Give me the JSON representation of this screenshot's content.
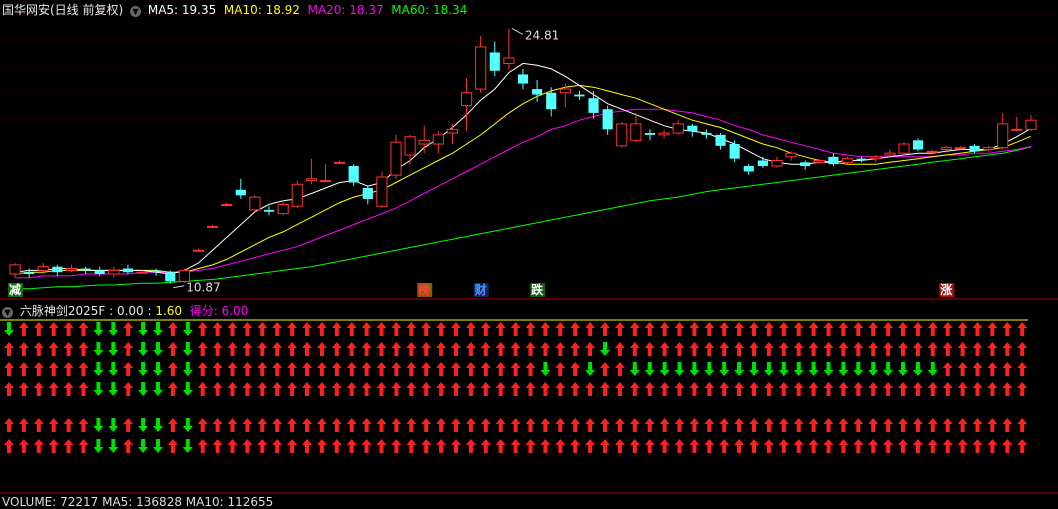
{
  "header": {
    "title": "国华网安(日线 前复权)",
    "ma5_label": "MA5: 19.35",
    "ma10_label": "MA10: 18.92",
    "ma20_label": "MA20: 18.37",
    "ma60_label": "MA60: 18.34"
  },
  "colors": {
    "up": "#ff3232",
    "down": "#54ffff",
    "ma5": "#ffffff",
    "ma10": "#ffff00",
    "ma20": "#ff00ff",
    "ma60": "#00ff00",
    "arrow_up": "#ff2020",
    "arrow_down": "#00e000"
  },
  "price_panel": {
    "high_label": "24.81",
    "low_label": "10.87",
    "signals": [
      {
        "text": "减",
        "color": "#ffffff",
        "bg": "#107010",
        "index": 0
      },
      {
        "text": "榜",
        "color": "#ff4040",
        "bg": "#806000",
        "index": 29
      },
      {
        "text": "财",
        "color": "#40a0ff",
        "bg": "#202060",
        "index": 33
      },
      {
        "text": "跌",
        "color": "#ffffff",
        "bg": "#106010",
        "index": 37
      },
      {
        "text": "涨",
        "color": "#ffffff",
        "bg": "#a01010",
        "index": 66
      }
    ]
  },
  "indicator": {
    "name": "六脉神剑2025F",
    "sep1": " : ",
    "v1": "0.00",
    "sep2": " : ",
    "v2": "1.60",
    "score_label": "得分: ",
    "score": "6.00"
  },
  "volume_label": "VOLUME: 72217  MA5: 136828  MA10: 112655",
  "chart_data": {
    "type": "candlestick",
    "ylim": [
      10.2,
      25.6
    ],
    "candles": [
      [
        11.4,
        11.9,
        11.2,
        12.0
      ],
      [
        11.5,
        11.4,
        11.2,
        11.7
      ],
      [
        11.6,
        11.8,
        11.4,
        12.0
      ],
      [
        11.8,
        11.5,
        11.3,
        11.9
      ],
      [
        11.6,
        11.7,
        11.5,
        11.9
      ],
      [
        11.7,
        11.6,
        11.4,
        11.8
      ],
      [
        11.6,
        11.4,
        11.3,
        11.8
      ],
      [
        11.4,
        11.6,
        11.2,
        11.8
      ],
      [
        11.7,
        11.5,
        11.4,
        11.9
      ],
      [
        11.5,
        11.5,
        11.4,
        11.6
      ],
      [
        11.6,
        11.5,
        11.3,
        11.7
      ],
      [
        11.5,
        11.0,
        10.87,
        11.6
      ],
      [
        11.0,
        11.6,
        10.9,
        11.7
      ],
      [
        12.7,
        12.7,
        12.6,
        12.8
      ],
      [
        14.0,
        14.0,
        13.9,
        14.1
      ],
      [
        15.2,
        15.2,
        15.1,
        15.3
      ],
      [
        16.0,
        15.7,
        15.5,
        16.6
      ],
      [
        14.9,
        15.6,
        14.8,
        15.7
      ],
      [
        14.9,
        14.8,
        14.6,
        15.1
      ],
      [
        14.7,
        15.2,
        14.6,
        15.4
      ],
      [
        15.1,
        16.3,
        15.0,
        16.5
      ],
      [
        16.5,
        16.6,
        16.3,
        17.7
      ],
      [
        16.5,
        16.5,
        16.4,
        17.4
      ],
      [
        17.5,
        17.5,
        17.4,
        17.6
      ],
      [
        17.3,
        16.4,
        16.2,
        17.4
      ],
      [
        16.1,
        15.5,
        15.2,
        16.2
      ],
      [
        15.1,
        16.7,
        15.0,
        17.0
      ],
      [
        16.8,
        18.6,
        16.6,
        19.0
      ],
      [
        17.9,
        18.9,
        17.4,
        19.0
      ],
      [
        18.5,
        18.7,
        18.0,
        19.5
      ],
      [
        18.5,
        19.0,
        18.0,
        19.2
      ],
      [
        19.1,
        19.3,
        18.5,
        19.6
      ],
      [
        20.6,
        21.3,
        19.2,
        22.1
      ],
      [
        21.5,
        23.8,
        21.3,
        24.4
      ],
      [
        23.5,
        22.5,
        22.2,
        24.1
      ],
      [
        22.9,
        23.2,
        22.6,
        24.81
      ],
      [
        22.3,
        21.8,
        21.5,
        22.6
      ],
      [
        21.5,
        21.2,
        20.8,
        22.0
      ],
      [
        21.3,
        20.4,
        20.0,
        21.6
      ],
      [
        21.3,
        21.5,
        20.5,
        21.8
      ],
      [
        21.2,
        21.1,
        20.9,
        21.4
      ],
      [
        21.0,
        20.2,
        19.9,
        21.4
      ],
      [
        20.4,
        19.3,
        19.0,
        20.6
      ],
      [
        18.4,
        19.6,
        18.3,
        19.7
      ],
      [
        18.7,
        19.6,
        18.6,
        20.2
      ],
      [
        19.1,
        19.0,
        18.7,
        19.3
      ],
      [
        19.0,
        19.1,
        18.8,
        19.3
      ],
      [
        19.1,
        19.6,
        19.0,
        19.8
      ],
      [
        19.5,
        19.2,
        18.9,
        19.6
      ],
      [
        19.1,
        19.0,
        18.8,
        19.3
      ],
      [
        19.0,
        18.4,
        18.2,
        19.1
      ],
      [
        18.5,
        17.7,
        17.5,
        18.7
      ],
      [
        17.3,
        17.0,
        16.8,
        17.4
      ],
      [
        17.6,
        17.3,
        17.2,
        17.8
      ],
      [
        17.3,
        17.6,
        17.2,
        17.8
      ],
      [
        17.8,
        18.0,
        17.6,
        18.1
      ],
      [
        17.5,
        17.3,
        17.1,
        17.6
      ],
      [
        17.5,
        17.6,
        17.4,
        17.7
      ],
      [
        17.8,
        17.4,
        17.3,
        18.0
      ],
      [
        17.5,
        17.7,
        17.4,
        17.8
      ],
      [
        17.7,
        17.6,
        17.5,
        17.8
      ],
      [
        17.7,
        17.8,
        17.5,
        17.9
      ],
      [
        17.9,
        18.0,
        17.8,
        18.2
      ],
      [
        18.0,
        18.5,
        17.9,
        18.6
      ],
      [
        18.7,
        18.2,
        18.1,
        18.8
      ],
      [
        18.1,
        18.1,
        18.0,
        18.2
      ],
      [
        18.2,
        18.3,
        18.1,
        18.4
      ],
      [
        18.3,
        18.3,
        18.2,
        18.4
      ],
      [
        18.4,
        18.1,
        18.0,
        18.5
      ],
      [
        18.2,
        18.3,
        18.1,
        18.4
      ],
      [
        18.3,
        19.6,
        18.2,
        20.2
      ],
      [
        19.3,
        19.3,
        19.2,
        20.0
      ],
      [
        19.3,
        19.8,
        19.2,
        20.1
      ]
    ],
    "ma5": [
      11.5,
      11.6,
      11.6,
      11.7,
      11.7,
      11.6,
      11.6,
      11.6,
      11.6,
      11.6,
      11.5,
      11.4,
      11.6,
      12.0,
      12.7,
      13.4,
      14.1,
      14.8,
      15.2,
      15.4,
      15.5,
      15.8,
      16.1,
      16.4,
      16.5,
      16.2,
      16.4,
      17.1,
      17.6,
      18.3,
      18.8,
      19.4,
      20.1,
      20.9,
      21.5,
      22.4,
      22.9,
      22.8,
      22.6,
      22.2,
      21.7,
      21.2,
      20.7,
      20.4,
      20.1,
      19.8,
      19.5,
      19.3,
      19.2,
      19.1,
      18.8,
      18.5,
      18.1,
      17.7,
      17.5,
      17.4,
      17.4,
      17.5,
      17.5,
      17.6,
      17.6,
      17.7,
      17.8,
      17.9,
      18.0,
      18.0,
      18.1,
      18.2,
      18.2,
      18.2,
      18.5,
      18.9,
      19.35
    ],
    "ma10": [
      11.4,
      11.5,
      11.5,
      11.6,
      11.6,
      11.6,
      11.6,
      11.6,
      11.6,
      11.6,
      11.6,
      11.5,
      11.5,
      11.7,
      11.9,
      12.2,
      12.6,
      13.0,
      13.4,
      13.7,
      14.1,
      14.5,
      14.9,
      15.3,
      15.6,
      15.8,
      16.0,
      16.4,
      16.8,
      17.2,
      17.6,
      18.0,
      18.5,
      19.0,
      19.6,
      20.2,
      20.7,
      21.1,
      21.4,
      21.6,
      21.7,
      21.6,
      21.4,
      21.2,
      21.0,
      20.7,
      20.4,
      20.1,
      19.8,
      19.6,
      19.4,
      19.1,
      18.8,
      18.5,
      18.3,
      18.0,
      17.8,
      17.6,
      17.5,
      17.4,
      17.4,
      17.4,
      17.5,
      17.6,
      17.7,
      17.8,
      17.9,
      18.0,
      18.1,
      18.2,
      18.3,
      18.6,
      18.92
    ],
    "ma20": [
      11.2,
      11.2,
      11.3,
      11.3,
      11.3,
      11.4,
      11.4,
      11.4,
      11.4,
      11.5,
      11.5,
      11.5,
      11.5,
      11.6,
      11.7,
      11.9,
      12.1,
      12.3,
      12.5,
      12.7,
      12.9,
      13.2,
      13.5,
      13.8,
      14.1,
      14.4,
      14.7,
      15.0,
      15.4,
      15.8,
      16.2,
      16.6,
      17.0,
      17.4,
      17.8,
      18.2,
      18.6,
      18.9,
      19.3,
      19.5,
      19.8,
      20.0,
      20.2,
      20.3,
      20.4,
      20.4,
      20.4,
      20.3,
      20.2,
      20.0,
      19.8,
      19.5,
      19.3,
      19.0,
      18.8,
      18.6,
      18.4,
      18.2,
      18.0,
      17.9,
      17.8,
      17.8,
      17.8,
      17.8,
      17.8,
      17.8,
      17.9,
      17.9,
      18.0,
      18.0,
      18.1,
      18.2,
      18.37
    ],
    "ma60": [
      10.6,
      10.6,
      10.65,
      10.7,
      10.7,
      10.75,
      10.8,
      10.8,
      10.85,
      10.9,
      10.9,
      10.95,
      11.0,
      11.05,
      11.1,
      11.2,
      11.3,
      11.4,
      11.5,
      11.6,
      11.7,
      11.8,
      11.95,
      12.1,
      12.25,
      12.4,
      12.55,
      12.7,
      12.85,
      13.0,
      13.15,
      13.3,
      13.45,
      13.6,
      13.75,
      13.9,
      14.05,
      14.2,
      14.35,
      14.5,
      14.65,
      14.8,
      14.95,
      15.1,
      15.25,
      15.4,
      15.5,
      15.6,
      15.75,
      15.9,
      16.0,
      16.1,
      16.2,
      16.3,
      16.4,
      16.5,
      16.6,
      16.7,
      16.8,
      16.9,
      17.0,
      17.1,
      17.2,
      17.3,
      17.4,
      17.5,
      17.6,
      17.7,
      17.8,
      17.9,
      18.0,
      18.15,
      18.34
    ]
  },
  "arrow_rows": [
    "DUUUUUDDUDDUDUUUUUUUUUUUUUUUUUUUUUUUUUUUUUUUUUUUUUUUUUUUUUUUUUUUUUUUUUUUUUUUUUUUUUUUUUUUUUUUUUUUUUUUUUUUUUUUUUUUUUUUUUUUUUUUU",
    "UUUUUUDDUDDUDUUUUUUUUUUUUUUUUUUUUUUUUUUUDUUUUUUUUUUUUUUUUUUUUUUUUUUUUUUUUUUUUUUUUUUUUUUUUUUUUUUUUUUUUUUUUUUUUUUUUUUUUUUUUUUUU",
    "UUUUUUDDUDDUDUUUUUUUUUUUUUUUUUUUUUUUDUUDUUDDDDDDDDDDDDDDDDDDDDDUUUUUUUUUUUUUUUUUUUUUUUUUUUUUUUUUUUUUUUUUUUUUUUUUUUUUUUUUUUUU",
    "UUUUUUDDUDDUDUUUUUUUUUUUUUUUUUUUUUUUUUUUUUUUUUUUUUUUUUUUUUUUUUUUUUUUUUUUUUUUUUUUUUUUUUUUUUUUUUUUUUUUUUUUUUUUUUUUUUUUUUUUUUUUU",
    "UUUUUUDDUDDUDUUUUUUUUUUUUUUUUUUUUUUUUUUUUUUUUUUUUUUUUUUUUUUUUUUUUUUUUUUUUUUUUUUUUUUUUUUUUUUUUUUUUUUUUUUUUUUUUUUUUUUUUUUUUUUUU",
    "UUUUUUDDUDDUDUUUUUUUUUUUUUUUUUUUUUUUUUUUUUUUUUUUUUUUUUUUUUUUUUUUUUUUUUUUUUUUUUUUUUUUUUUUUUUUUUUUUUUUUUUUUUUUUUUUUUUUUUUUUUUUU"
  ]
}
